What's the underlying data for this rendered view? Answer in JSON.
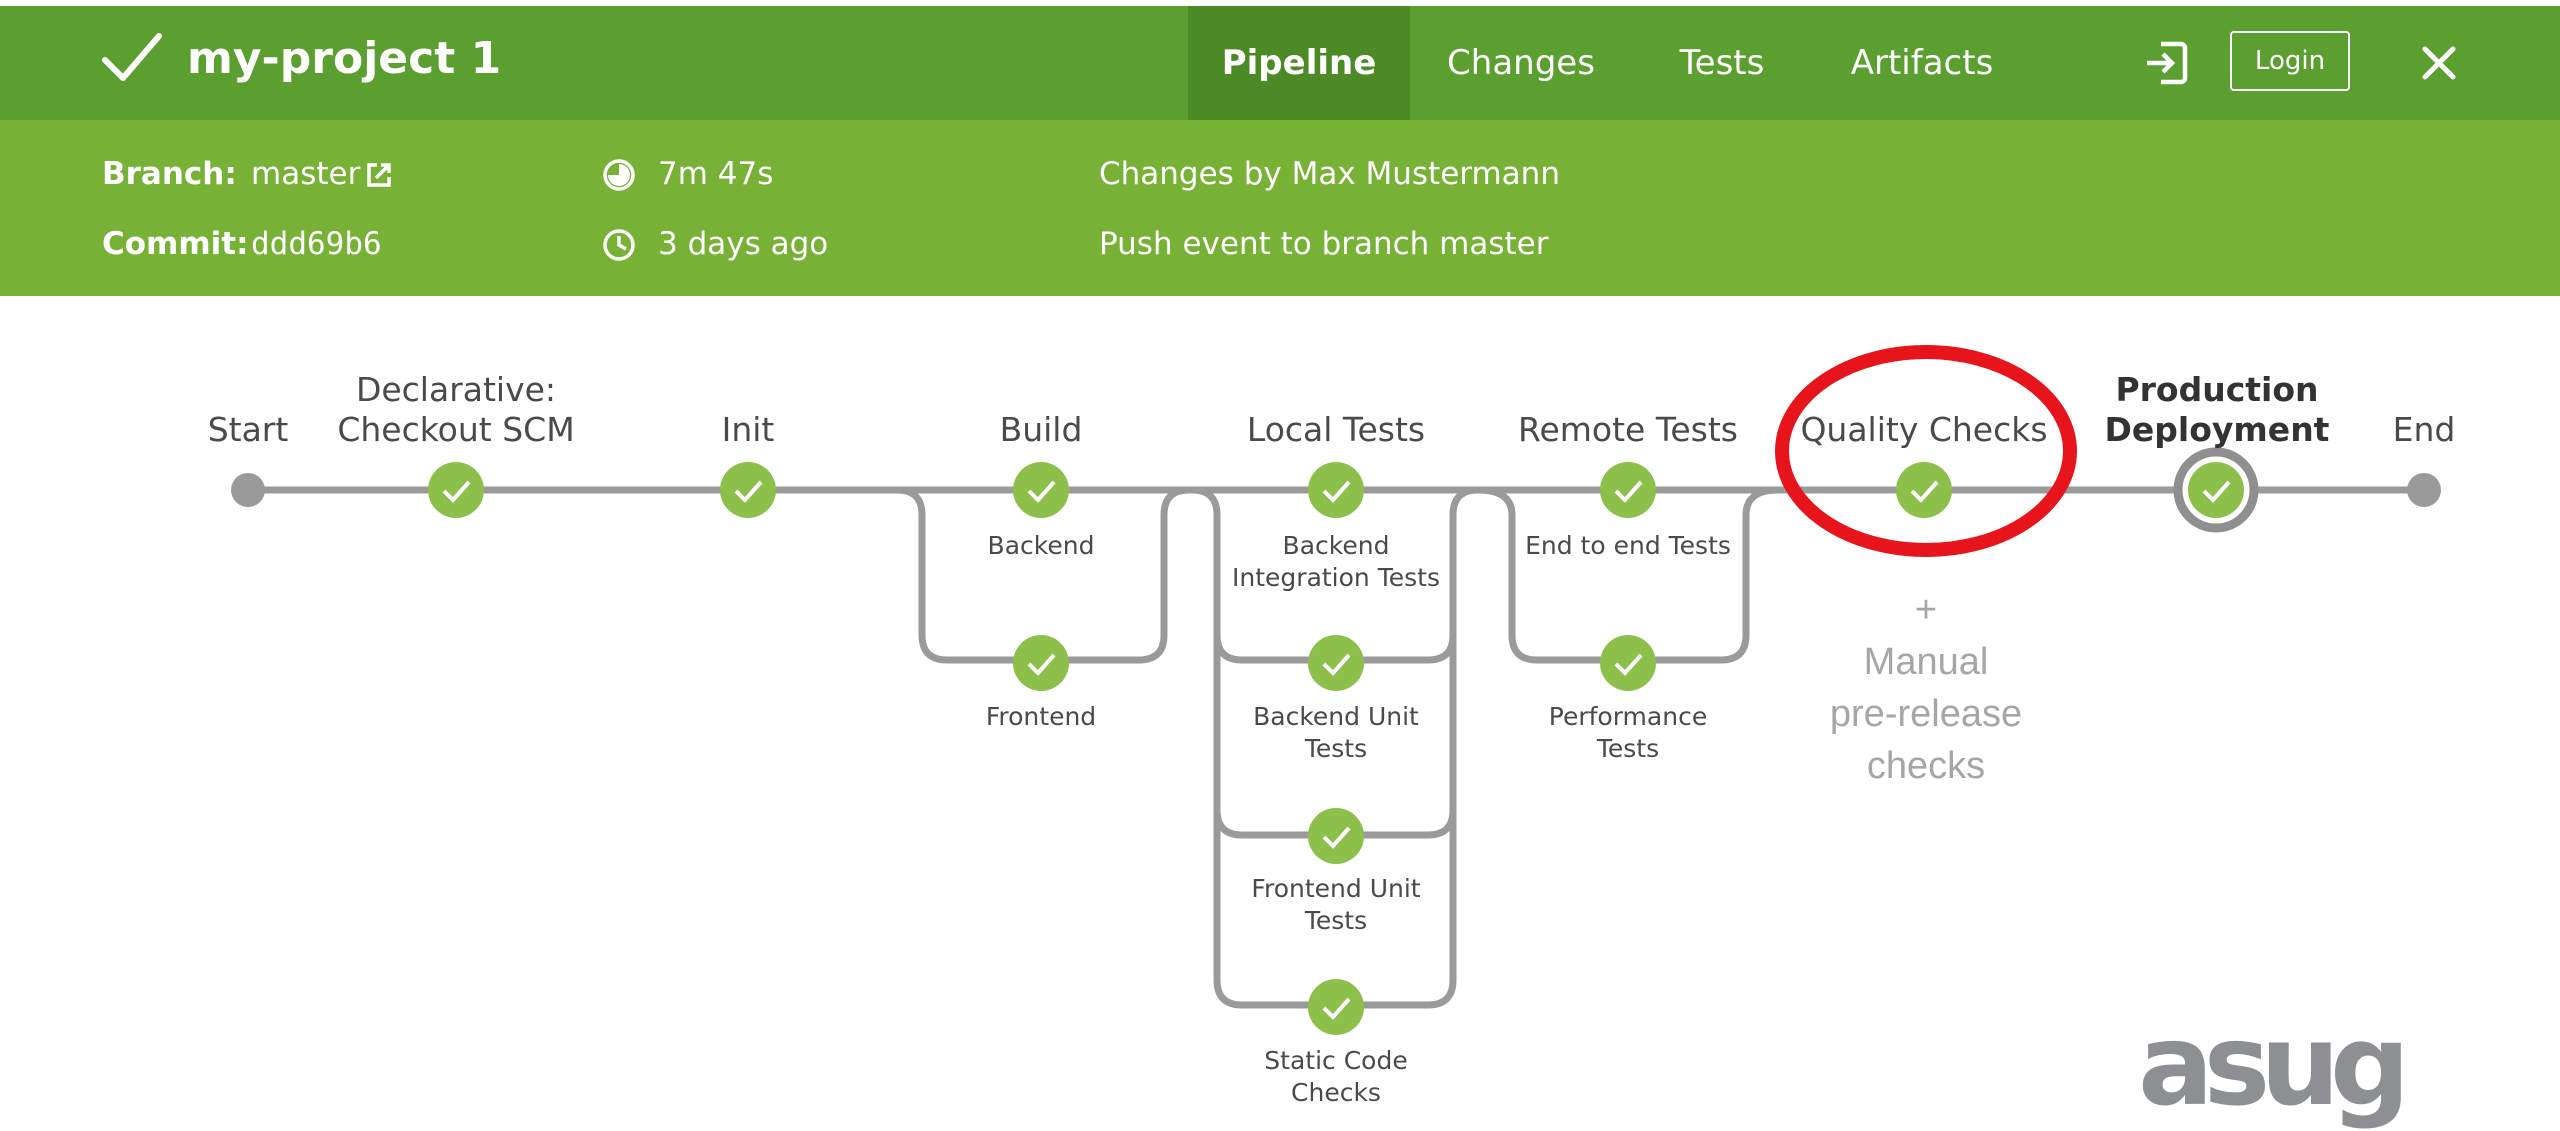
{
  "header": {
    "project_title": "my-project 1",
    "tabs": [
      {
        "label": "Pipeline",
        "active": true
      },
      {
        "label": "Changes",
        "active": false
      },
      {
        "label": "Tests",
        "active": false
      },
      {
        "label": "Artifacts",
        "active": false
      }
    ],
    "login_label": "Login",
    "icons": {
      "status": "checkmark-icon",
      "exit": "sign-in-icon",
      "close": "close-icon"
    }
  },
  "summary": {
    "branch_label": "Branch:",
    "branch_value": "master",
    "commit_label": "Commit:",
    "commit_value": "ddd69b6",
    "duration": "7m 47s",
    "age": "3 days ago",
    "changes_by": "Changes by Max Mustermann",
    "trigger": "Push event to branch master"
  },
  "pipeline": {
    "stages": [
      {
        "id": "start",
        "title": "Start"
      },
      {
        "id": "checkout",
        "title_line1": "Declarative:",
        "title_line2": "Checkout SCM"
      },
      {
        "id": "init",
        "title": "Init"
      },
      {
        "id": "build",
        "title": "Build",
        "branches": [
          "Backend",
          "Frontend"
        ]
      },
      {
        "id": "local-tests",
        "title": "Local Tests",
        "branches": [
          {
            "line1": "Backend",
            "line2": "Integration Tests"
          },
          {
            "line1": "Backend Unit",
            "line2": "Tests"
          },
          {
            "line1": "Frontend Unit",
            "line2": "Tests"
          },
          {
            "line1": "Static Code",
            "line2": "Checks"
          }
        ]
      },
      {
        "id": "remote-tests",
        "title": "Remote Tests",
        "branches": [
          {
            "line1": "End to end Tests",
            "line2": ""
          },
          {
            "line1": "Performance",
            "line2": "Tests"
          }
        ]
      },
      {
        "id": "quality-checks",
        "title": "Quality Checks"
      },
      {
        "id": "production",
        "title_line1": "Production",
        "title_line2": "Deployment",
        "current": true
      },
      {
        "id": "end",
        "title": "End"
      }
    ],
    "status": "success"
  },
  "annotation": {
    "lines": [
      "+",
      "Manual",
      "pre-release",
      "checks"
    ],
    "highlight_color": "#e8141b"
  },
  "logo_text": "asug",
  "colors": {
    "topbar": "#5a9f2f",
    "subbar": "#77b236",
    "active_tab": "#4b8a25",
    "node_success": "#8cc04b",
    "track": "#999999"
  }
}
